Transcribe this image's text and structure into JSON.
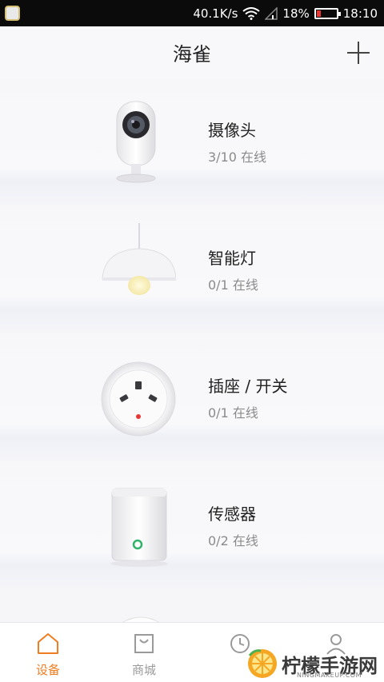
{
  "status_bar": {
    "network_speed": "40.1K/s",
    "battery_percent": "18%",
    "time": "18:10",
    "battery_level": 0.18
  },
  "header": {
    "title": "海雀",
    "add_icon": "plus-icon"
  },
  "devices": [
    {
      "name": "摄像头",
      "status": "3/10 在线",
      "icon": "camera-icon"
    },
    {
      "name": "智能灯",
      "status": "0/1 在线",
      "icon": "lamp-icon"
    },
    {
      "name": "插座 / 开关",
      "status": "0/1 在线",
      "icon": "socket-icon"
    },
    {
      "name": "传感器",
      "status": "0/2 在线",
      "icon": "sensor-icon"
    }
  ],
  "bottom_nav": [
    {
      "label": "设备",
      "icon": "home-icon",
      "active": true
    },
    {
      "label": "商城",
      "icon": "shopping-bag-icon",
      "active": false
    },
    {
      "label": "",
      "icon": "clock-icon",
      "active": false
    },
    {
      "label": "",
      "icon": "person-icon",
      "active": false
    }
  ],
  "watermark": {
    "text": "柠檬手游网",
    "subtext": "NINGMAKEUP.COM"
  },
  "colors": {
    "accent": "#ef7d22",
    "inactive": "#999999",
    "status_text": "#8b8b8b",
    "battery_low": "#e53935"
  }
}
